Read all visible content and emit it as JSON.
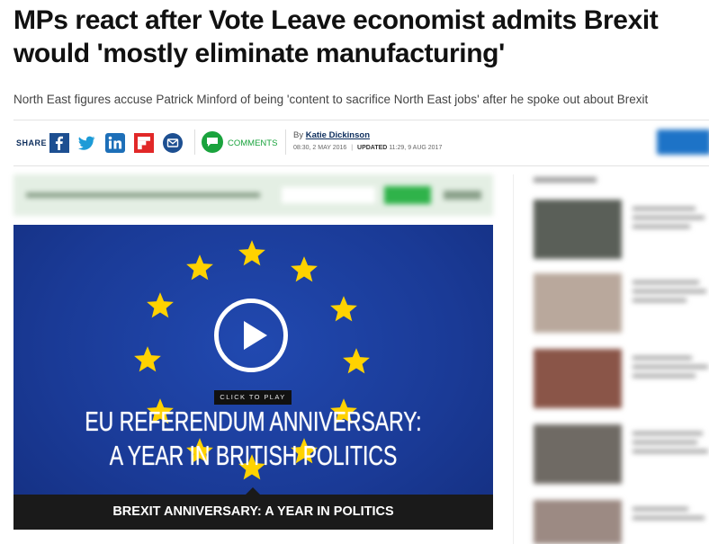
{
  "article": {
    "headline": "MPs react after Vote Leave economist admits Brexit would 'mostly eliminate manufacturing'",
    "standfirst": "North East figures accuse Patrick Minford of being 'content to sacrifice North East jobs' after he spoke out about Brexit"
  },
  "share_bar": {
    "share_label": "SHARE",
    "icons": [
      "facebook-icon",
      "twitter-icon",
      "linkedin-icon",
      "flipboard-icon",
      "email-icon"
    ],
    "comments_label": "COMMENTS",
    "byline_prefix": "By",
    "author": "Katie Dickinson",
    "published": "08:30, 2 MAY 2016",
    "updated_label": "UPDATED",
    "updated": "11:29, 9 AUG 2017"
  },
  "video": {
    "click_to_play": "CLICK TO PLAY",
    "title_line1": "EU REFERENDUM ANNIVERSARY:",
    "title_line2": "A YEAR IN BRITISH POLITICS",
    "caption": "BREXIT ANNIVERSARY: A YEAR IN POLITICS",
    "background_color": "#1b3d9c",
    "star_color": "#ffd200"
  },
  "colors": {
    "brand_navy": "#0c2d5c",
    "comments_green": "#1aa33d",
    "facebook": "#1d4f91",
    "twitter": "#1d9bd7",
    "linkedin": "#1d6fb8",
    "flipboard": "#e12828",
    "email": "#1d4f91"
  }
}
